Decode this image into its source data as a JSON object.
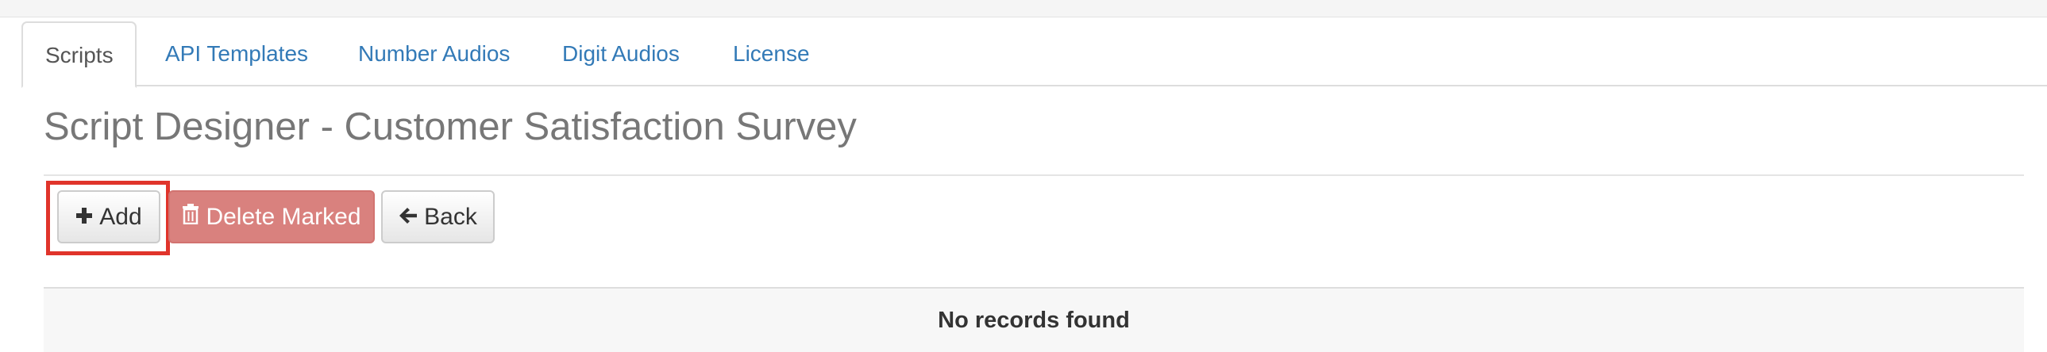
{
  "tabs": [
    {
      "label": "Scripts",
      "active": true
    },
    {
      "label": "API Templates",
      "active": false
    },
    {
      "label": "Number Audios",
      "active": false
    },
    {
      "label": "Digit Audios",
      "active": false
    },
    {
      "label": "License",
      "active": false
    }
  ],
  "page": {
    "title": "Script Designer - Customer Satisfaction Survey"
  },
  "toolbar": {
    "add_label": "Add",
    "delete_label": "Delete Marked",
    "back_label": "Back"
  },
  "table": {
    "empty_message": "No records found"
  },
  "icons": {
    "add": "plus-icon",
    "delete": "trash-icon",
    "back": "arrow-left-icon"
  },
  "colors": {
    "link": "#337ab7",
    "danger": "#d9817e",
    "highlight": "#e0342b",
    "title": "#777777"
  }
}
